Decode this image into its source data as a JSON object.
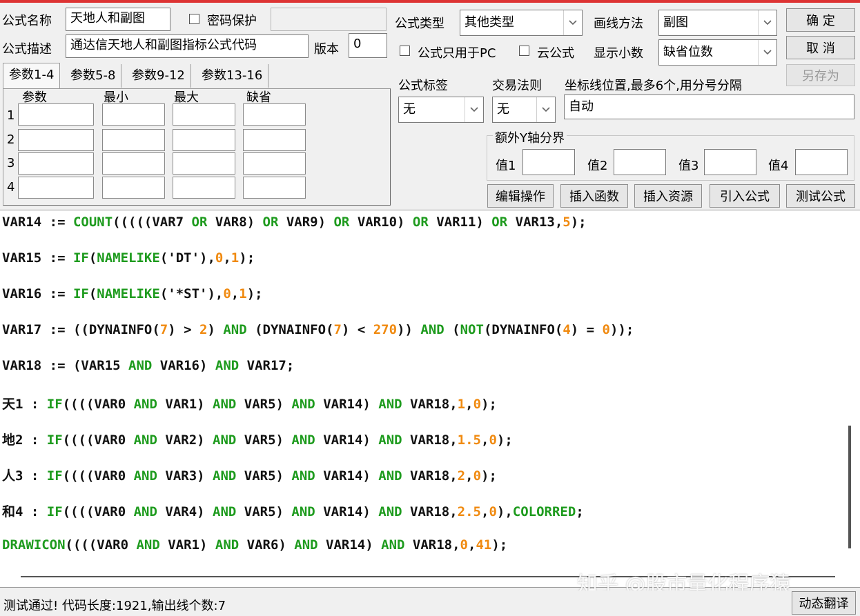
{
  "labels": {
    "formula_name": "公式名称",
    "password_protect": "密码保护",
    "formula_desc": "公式描述",
    "version": "版本",
    "formula_type": "公式类型",
    "draw_method": "画线方法",
    "pc_only": "公式只用于PC",
    "cloud_formula": "云公式",
    "show_decimals": "显示小数",
    "formula_tag": "公式标签",
    "trade_rule": "交易法则",
    "axis_position": "坐标线位置,最多6个,用分号分隔",
    "extra_y_axis": "额外Y轴分界",
    "val1": "值1",
    "val2": "值2",
    "val3": "值3",
    "val4": "值4"
  },
  "fields": {
    "formula_name": "天地人和副图",
    "password": "",
    "formula_desc": "通达信天地人和副图指标公式代码",
    "version": "0",
    "formula_type": "其他类型",
    "draw_method": "副图",
    "show_decimals": "缺省位数",
    "formula_tag": "无",
    "trade_rule": "无",
    "axis_position": "自动"
  },
  "buttons": {
    "ok": "确 定",
    "cancel": "取 消",
    "save_as": "另存为",
    "edit_ops": "编辑操作",
    "insert_func": "插入函数",
    "insert_res": "插入资源",
    "import_formula": "引入公式",
    "test_formula": "测试公式",
    "dynamic_translate": "动态翻译"
  },
  "tabs": [
    "参数1-4",
    "参数5-8",
    "参数9-12",
    "参数13-16"
  ],
  "param_table": {
    "headers": [
      "参数",
      "最小",
      "最大",
      "缺省"
    ],
    "rows": [
      "1",
      "2",
      "3",
      "4"
    ]
  },
  "code_lines": [
    [
      {
        "t": "VAR14 := ",
        "c": "plain"
      },
      {
        "t": "COUNT",
        "c": "kw"
      },
      {
        "t": "(((((VAR7 ",
        "c": "plain"
      },
      {
        "t": "OR",
        "c": "kw"
      },
      {
        "t": " VAR8) ",
        "c": "plain"
      },
      {
        "t": "OR",
        "c": "kw"
      },
      {
        "t": " VAR9) ",
        "c": "plain"
      },
      {
        "t": "OR",
        "c": "kw"
      },
      {
        "t": " VAR10) ",
        "c": "plain"
      },
      {
        "t": "OR",
        "c": "kw"
      },
      {
        "t": " VAR11) ",
        "c": "plain"
      },
      {
        "t": "OR",
        "c": "kw"
      },
      {
        "t": " VAR13,",
        "c": "plain"
      },
      {
        "t": "5",
        "c": "num"
      },
      {
        "t": ");",
        "c": "plain"
      }
    ],
    [
      {
        "t": "VAR15 := ",
        "c": "plain"
      },
      {
        "t": "IF",
        "c": "kw"
      },
      {
        "t": "(",
        "c": "plain"
      },
      {
        "t": "NAMELIKE",
        "c": "kw"
      },
      {
        "t": "('DT'),",
        "c": "plain"
      },
      {
        "t": "0",
        "c": "num"
      },
      {
        "t": ",",
        "c": "plain"
      },
      {
        "t": "1",
        "c": "num"
      },
      {
        "t": ");",
        "c": "plain"
      }
    ],
    [
      {
        "t": "VAR16 := ",
        "c": "plain"
      },
      {
        "t": "IF",
        "c": "kw"
      },
      {
        "t": "(",
        "c": "plain"
      },
      {
        "t": "NAMELIKE",
        "c": "kw"
      },
      {
        "t": "('*ST'),",
        "c": "plain"
      },
      {
        "t": "0",
        "c": "num"
      },
      {
        "t": ",",
        "c": "plain"
      },
      {
        "t": "1",
        "c": "num"
      },
      {
        "t": ");",
        "c": "plain"
      }
    ],
    [
      {
        "t": "VAR17 := ((DYNAINFO(",
        "c": "plain"
      },
      {
        "t": "7",
        "c": "num"
      },
      {
        "t": ") > ",
        "c": "plain"
      },
      {
        "t": "2",
        "c": "num"
      },
      {
        "t": ") ",
        "c": "plain"
      },
      {
        "t": "AND",
        "c": "kw"
      },
      {
        "t": " (DYNAINFO(",
        "c": "plain"
      },
      {
        "t": "7",
        "c": "num"
      },
      {
        "t": ") < ",
        "c": "plain"
      },
      {
        "t": "270",
        "c": "num"
      },
      {
        "t": ")) ",
        "c": "plain"
      },
      {
        "t": "AND",
        "c": "kw"
      },
      {
        "t": " (",
        "c": "plain"
      },
      {
        "t": "NOT",
        "c": "kw"
      },
      {
        "t": "(DYNAINFO(",
        "c": "plain"
      },
      {
        "t": "4",
        "c": "num"
      },
      {
        "t": ") = ",
        "c": "plain"
      },
      {
        "t": "0",
        "c": "num"
      },
      {
        "t": "));",
        "c": "plain"
      }
    ],
    [
      {
        "t": "VAR18 := (VAR15 ",
        "c": "plain"
      },
      {
        "t": "AND",
        "c": "kw"
      },
      {
        "t": " VAR16) ",
        "c": "plain"
      },
      {
        "t": "AND",
        "c": "kw"
      },
      {
        "t": " VAR17;",
        "c": "plain"
      }
    ],
    [
      {
        "t": "天1 : ",
        "c": "plain"
      },
      {
        "t": "IF",
        "c": "kw"
      },
      {
        "t": "((((VAR0 ",
        "c": "plain"
      },
      {
        "t": "AND",
        "c": "kw"
      },
      {
        "t": " VAR1) ",
        "c": "plain"
      },
      {
        "t": "AND",
        "c": "kw"
      },
      {
        "t": " VAR5) ",
        "c": "plain"
      },
      {
        "t": "AND",
        "c": "kw"
      },
      {
        "t": " VAR14) ",
        "c": "plain"
      },
      {
        "t": "AND",
        "c": "kw"
      },
      {
        "t": " VAR18,",
        "c": "plain"
      },
      {
        "t": "1",
        "c": "num"
      },
      {
        "t": ",",
        "c": "plain"
      },
      {
        "t": "0",
        "c": "num"
      },
      {
        "t": ");",
        "c": "plain"
      }
    ],
    [
      {
        "t": "地2 : ",
        "c": "plain"
      },
      {
        "t": "IF",
        "c": "kw"
      },
      {
        "t": "((((VAR0 ",
        "c": "plain"
      },
      {
        "t": "AND",
        "c": "kw"
      },
      {
        "t": " VAR2) ",
        "c": "plain"
      },
      {
        "t": "AND",
        "c": "kw"
      },
      {
        "t": " VAR5) ",
        "c": "plain"
      },
      {
        "t": "AND",
        "c": "kw"
      },
      {
        "t": " VAR14) ",
        "c": "plain"
      },
      {
        "t": "AND",
        "c": "kw"
      },
      {
        "t": " VAR18,",
        "c": "plain"
      },
      {
        "t": "1.5",
        "c": "num"
      },
      {
        "t": ",",
        "c": "plain"
      },
      {
        "t": "0",
        "c": "num"
      },
      {
        "t": ");",
        "c": "plain"
      }
    ],
    [
      {
        "t": "人3 : ",
        "c": "plain"
      },
      {
        "t": "IF",
        "c": "kw"
      },
      {
        "t": "((((VAR0 ",
        "c": "plain"
      },
      {
        "t": "AND",
        "c": "kw"
      },
      {
        "t": " VAR3) ",
        "c": "plain"
      },
      {
        "t": "AND",
        "c": "kw"
      },
      {
        "t": " VAR5) ",
        "c": "plain"
      },
      {
        "t": "AND",
        "c": "kw"
      },
      {
        "t": " VAR14) ",
        "c": "plain"
      },
      {
        "t": "AND",
        "c": "kw"
      },
      {
        "t": " VAR18,",
        "c": "plain"
      },
      {
        "t": "2",
        "c": "num"
      },
      {
        "t": ",",
        "c": "plain"
      },
      {
        "t": "0",
        "c": "num"
      },
      {
        "t": ");",
        "c": "plain"
      }
    ],
    [
      {
        "t": "和4 : ",
        "c": "plain"
      },
      {
        "t": "IF",
        "c": "kw"
      },
      {
        "t": "((((VAR0 ",
        "c": "plain"
      },
      {
        "t": "AND",
        "c": "kw"
      },
      {
        "t": " VAR4) ",
        "c": "plain"
      },
      {
        "t": "AND",
        "c": "kw"
      },
      {
        "t": " VAR5) ",
        "c": "plain"
      },
      {
        "t": "AND",
        "c": "kw"
      },
      {
        "t": " VAR14) ",
        "c": "plain"
      },
      {
        "t": "AND",
        "c": "kw"
      },
      {
        "t": " VAR18,",
        "c": "plain"
      },
      {
        "t": "2.5",
        "c": "num"
      },
      {
        "t": ",",
        "c": "plain"
      },
      {
        "t": "0",
        "c": "num"
      },
      {
        "t": "),",
        "c": "plain"
      },
      {
        "t": "COLORRED",
        "c": "kw"
      },
      {
        "t": ";",
        "c": "plain"
      }
    ],
    [
      {
        "t": "DRAWICON",
        "c": "kw"
      },
      {
        "t": "((((VAR0 ",
        "c": "plain"
      },
      {
        "t": "AND",
        "c": "kw"
      },
      {
        "t": " VAR1) ",
        "c": "plain"
      },
      {
        "t": "AND",
        "c": "kw"
      },
      {
        "t": " VAR6) ",
        "c": "plain"
      },
      {
        "t": "AND",
        "c": "kw"
      },
      {
        "t": " VAR14) ",
        "c": "plain"
      },
      {
        "t": "AND",
        "c": "kw"
      },
      {
        "t": " VAR18,",
        "c": "plain"
      },
      {
        "t": "0",
        "c": "num"
      },
      {
        "t": ",",
        "c": "plain"
      },
      {
        "t": "41",
        "c": "num"
      },
      {
        "t": ");",
        "c": "plain"
      }
    ]
  ],
  "colors": {
    "keyword": "#1e9b1e",
    "number": "#f08a10",
    "text": "#111111"
  },
  "status": "测试通过! 代码长度:1921,输出线个数:7",
  "watermark": "知乎 @股市量化程序猿",
  "icons": {
    "dropdown": "chevron-down-icon",
    "checkbox": "checkbox-icon"
  }
}
